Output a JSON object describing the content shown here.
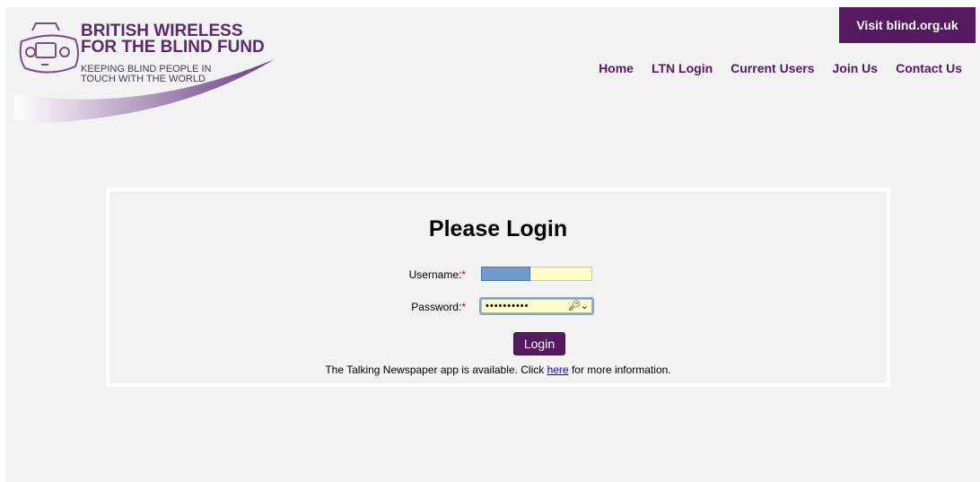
{
  "logo": {
    "title_line1": "BRITISH WIRELESS",
    "title_line2": "FOR THE BLIND FUND",
    "tagline_line1": "KEEPING BLIND PEOPLE IN",
    "tagline_line2": "TOUCH WITH THE WORLD",
    "icon": "radio-icon"
  },
  "header": {
    "visit_label": "Visit blind.org.uk"
  },
  "nav": {
    "items": [
      {
        "label": "Home"
      },
      {
        "label": "LTN Login"
      },
      {
        "label": "Current Users"
      },
      {
        "label": "Join Us"
      },
      {
        "label": "Contact Us"
      }
    ]
  },
  "login": {
    "title": "Please Login",
    "username_label": "Username:",
    "password_label": "Password:",
    "required_mark": "*",
    "password_value": "••••••••••",
    "key_icon": "password-key-icon",
    "button_label": "Login",
    "info_prefix": "The Talking Newspaper app is available. Click ",
    "info_link": "here",
    "info_suffix": " for more information."
  },
  "colors": {
    "brand_purple": "#55195f",
    "page_bg": "#f2f2f2",
    "input_bg": "#ffffcc",
    "required": "#cc0000",
    "link": "#0000ee"
  }
}
